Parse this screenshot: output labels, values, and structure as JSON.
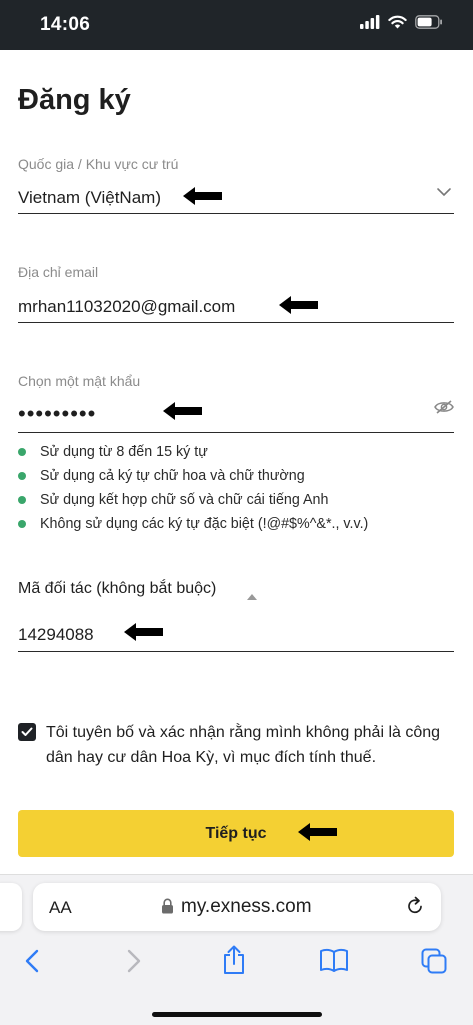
{
  "status": {
    "time": "14:06"
  },
  "form": {
    "title": "Đăng ký",
    "country": {
      "label": "Quốc gia / Khu vực cư trú",
      "value": "Vietnam (ViệtNam)"
    },
    "email": {
      "label": "Địa chỉ email",
      "value": "mrhan11032020@gmail.com"
    },
    "password": {
      "label": "Chọn một mật khẩu",
      "value": "•••••••••",
      "rules": [
        "Sử dụng từ 8 đến 15 ký tự",
        "Sử dụng cả ký tự chữ hoa và chữ thường",
        "Sử dụng kết hợp chữ số và chữ cái tiếng Anh",
        "Không sử dụng các ký tự đặc biệt (!@#$%^&*., v.v.)"
      ]
    },
    "partner": {
      "label": "Mã đối tác (không bắt buộc)",
      "value": "14294088"
    },
    "consent": {
      "checked": true,
      "text": "Tôi tuyên bố và xác nhận rằng mình không phải là công dân hay cư dân Hoa Kỳ, vì mục đích tính thuế."
    },
    "continue_label": "Tiếp tục"
  },
  "browser": {
    "aa_label": "AA",
    "url": "my.exness.com",
    "icons": [
      "back-icon",
      "forward-icon",
      "share-icon",
      "bookmarks-icon",
      "tabs-icon",
      "reload-icon",
      "lock-icon"
    ]
  },
  "colors": {
    "button": "#f4d033",
    "bullet": "#3aa66b",
    "statusbar": "#202529"
  }
}
